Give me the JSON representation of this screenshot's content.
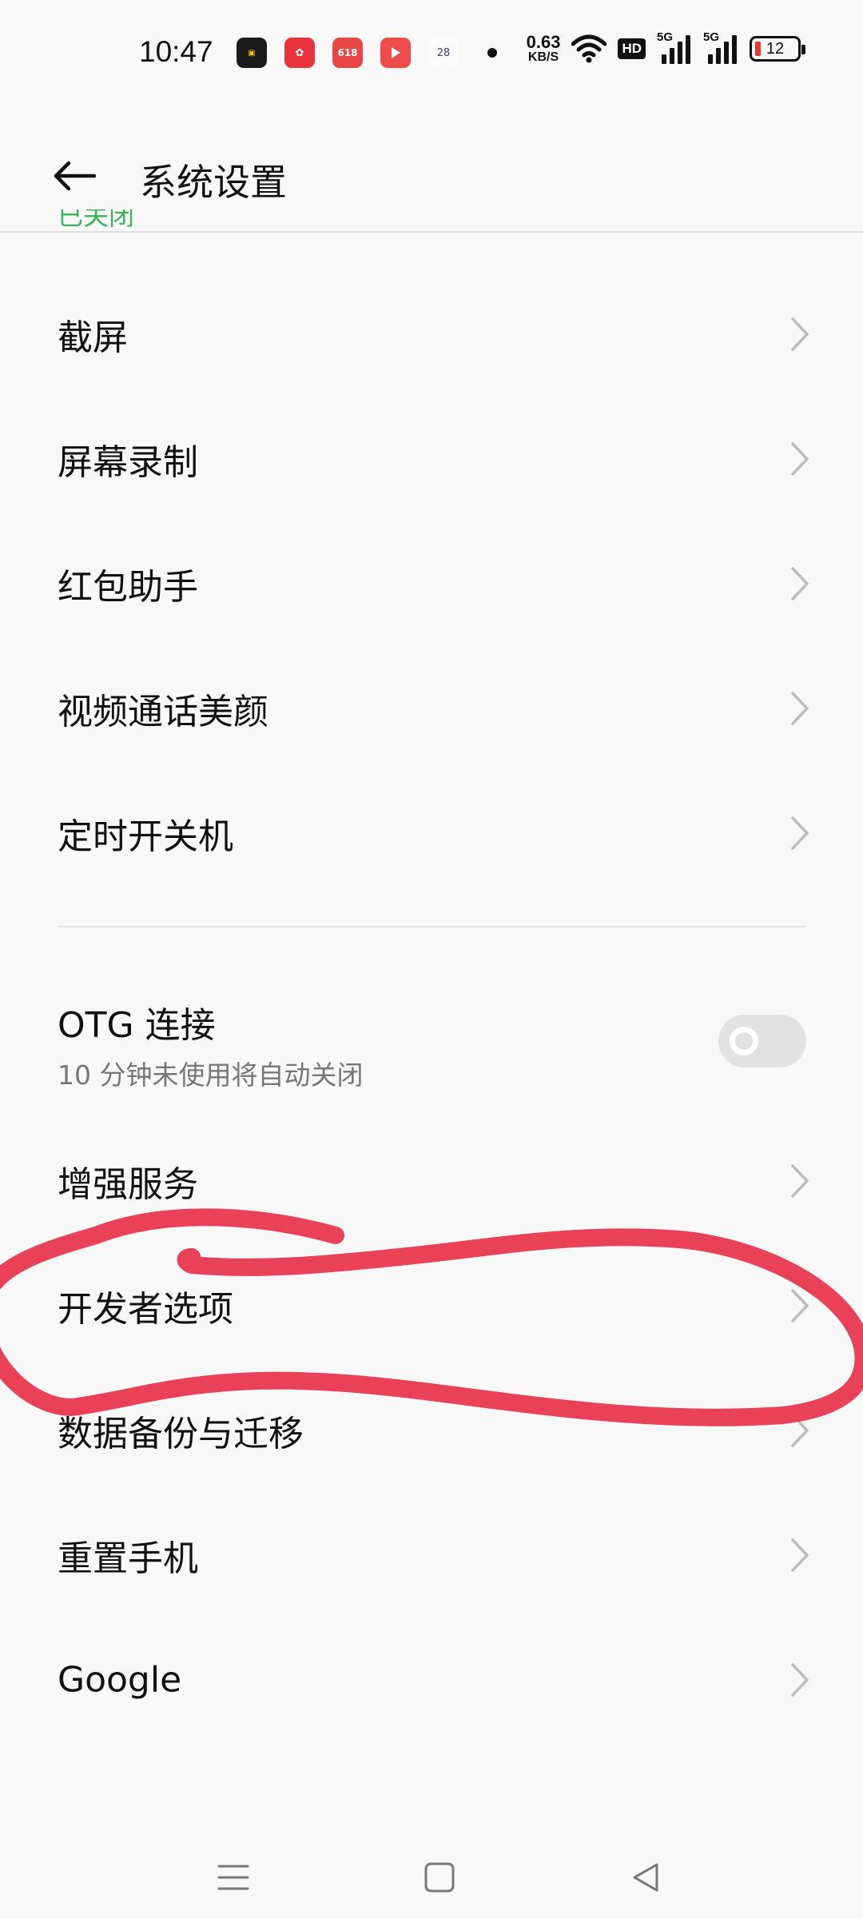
{
  "status_bar": {
    "time": "10:47",
    "notification_icons": [
      "app-icon",
      "app-icon",
      "618-icon",
      "play-icon",
      "calendar-icon"
    ],
    "calendar_day": "28",
    "net_speed_value": "0.63",
    "net_speed_unit": "KB/S",
    "hd_label": "HD",
    "signal_1_label": "5G",
    "signal_2_label": "5G",
    "battery_level": "12",
    "battery_color": "#e53935"
  },
  "header": {
    "back_icon": "arrow-left-icon",
    "title": "系统设置"
  },
  "clipped_above": "已关闭",
  "items": [
    {
      "label": "截屏"
    },
    {
      "label": "屏幕录制"
    },
    {
      "label": "红包助手"
    },
    {
      "label": "视频通话美颜"
    },
    {
      "label": "定时开关机"
    }
  ],
  "otg": {
    "label": "OTG 连接",
    "subtitle": "10 分钟未使用将自动关闭",
    "enabled": false
  },
  "items2": [
    {
      "label": "增强服务"
    },
    {
      "label": "开发者选项"
    },
    {
      "label": "数据备份与迁移"
    },
    {
      "label": "重置手机"
    },
    {
      "label": "Google"
    }
  ],
  "annotation_color": "#e8384f",
  "navbar": {
    "buttons": [
      "menu-icon",
      "home-icon",
      "back-triangle-icon"
    ]
  }
}
